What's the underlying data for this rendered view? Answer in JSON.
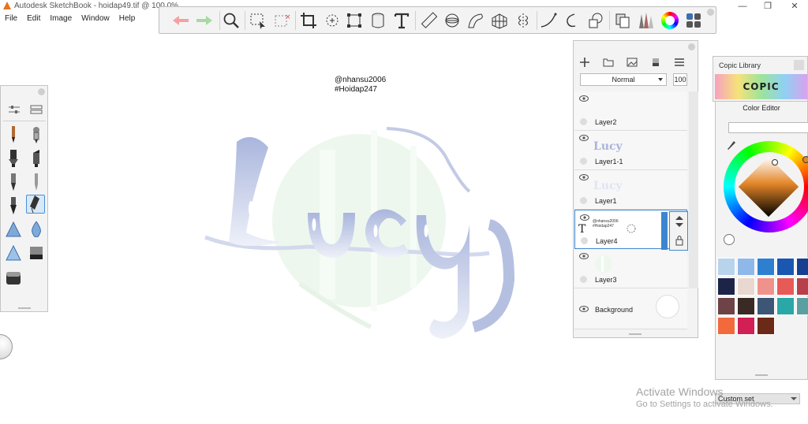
{
  "window": {
    "title": "Autodesk SketchBook - hoidap49.tif @ 100.0%",
    "minimize": "—",
    "maximize": "❐",
    "close": "✕"
  },
  "menu": [
    "File",
    "Edit",
    "Image",
    "Window",
    "Help"
  ],
  "toolbar_icons": [
    "undo-icon",
    "redo-icon",
    "zoom-icon",
    "select-icon",
    "crop-select-icon",
    "crop-icon",
    "transform-icon",
    "distort-icon",
    "fill-icon",
    "text-icon",
    "ruler-icon",
    "ellipse-guide-icon",
    "french-curve-icon",
    "perspective-icon",
    "symmetry-icon",
    "stroke-icon",
    "steady-stroke-icon",
    "shape-icon",
    "copy-icon",
    "brush-library-icon",
    "color-wheel-icon",
    "toolbar-menu-icon"
  ],
  "canvas": {
    "handle": "@nhansu2006",
    "tag": "#Hoidap247",
    "art_text": "Lucy"
  },
  "layers": {
    "blend_mode": "Normal",
    "opacity": "100",
    "items": [
      {
        "name": "Layer2"
      },
      {
        "name": "Layer1-1"
      },
      {
        "name": "Layer1"
      },
      {
        "name": "Layer4",
        "thumb_line1": "@nhansu2006",
        "thumb_line2": "#Hoidap247"
      },
      {
        "name": "Layer3"
      },
      {
        "name": "Background"
      }
    ]
  },
  "copic": {
    "label": "Copic Library",
    "logo": "COPIC"
  },
  "color_editor": {
    "title": "Color Editor",
    "swatches": [
      "#b8d3ec",
      "#8fb8ea",
      "#2f7fd0",
      "#1a57b0",
      "#173f91",
      "#1c2548",
      "#e9d8cf",
      "#f0928c",
      "#e85a57",
      "#b8404b",
      "#6d4348",
      "#3a2a25",
      "#3d5676",
      "#2aa7a7",
      "#5aa0a0",
      "#f26a3c",
      "#d21f56",
      "#6b2a17"
    ],
    "current_color": "#e38528"
  },
  "custom_set": "Custom set",
  "activate": {
    "line1": "Activate Windows",
    "line2": "Go to Settings to activate Windows."
  }
}
